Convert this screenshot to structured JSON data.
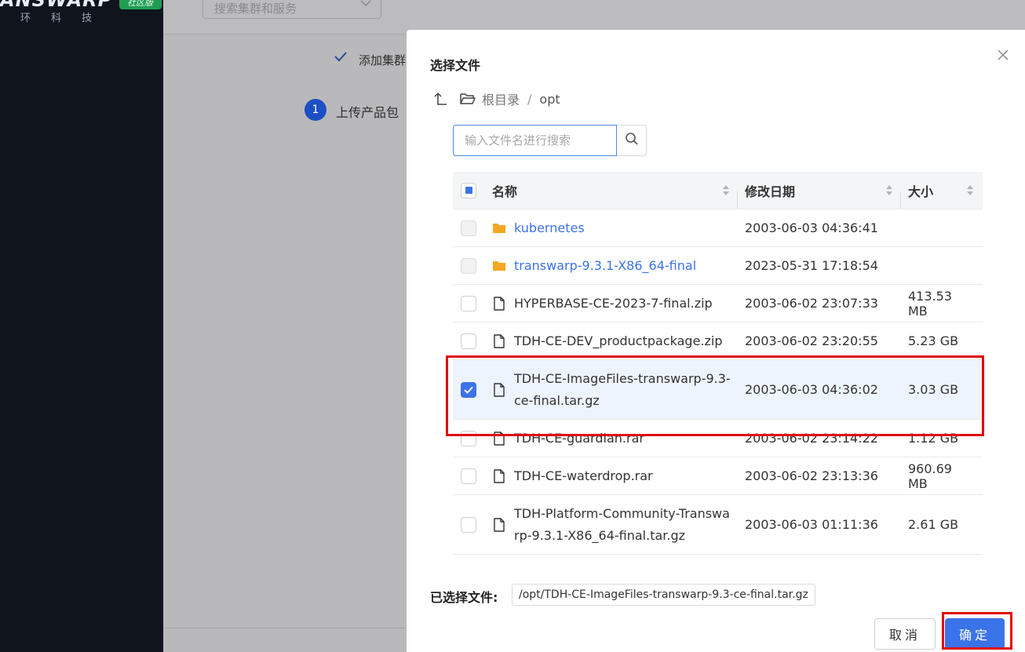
{
  "sidebar": {
    "logo_text": "ANSWARP",
    "logo_badge": "社区版",
    "logo_sub": "环科技"
  },
  "background": {
    "search_placeholder": "搜索集群和服务",
    "step_check_text": "添加集群",
    "step_number": "1",
    "step_text": "上传产品包"
  },
  "dialog": {
    "title": "选择文件",
    "breadcrumb": {
      "root": "根目录",
      "separator": "/",
      "current": "opt"
    },
    "search_placeholder": "输入文件名进行搜索",
    "columns": {
      "name": "名称",
      "date": "修改日期",
      "size": "大小"
    },
    "rows": [
      {
        "type": "folder",
        "name": "kubernetes",
        "date": "2003-06-03 04:36:41",
        "size": "",
        "checked": false,
        "disabled": true
      },
      {
        "type": "folder",
        "name": "transwarp-9.3.1-X86_64-final",
        "date": "2023-05-31 17:18:54",
        "size": "",
        "checked": false,
        "disabled": true
      },
      {
        "type": "file",
        "name": "HYPERBASE-CE-2023-7-final.zip",
        "date": "2003-06-02 23:07:33",
        "size": "413.53 MB",
        "checked": false
      },
      {
        "type": "file",
        "name": "TDH-CE-DEV_productpackage.zip",
        "date": "2003-06-02 23:20:55",
        "size": "5.23 GB",
        "checked": false
      },
      {
        "type": "file",
        "name": "TDH-CE-ImageFiles-transwarp-9.3-ce-final.tar.gz",
        "date": "2003-06-03 04:36:02",
        "size": "3.03 GB",
        "checked": true
      },
      {
        "type": "file",
        "name": "TDH-CE-guardian.rar",
        "date": "2003-06-02 23:14:22",
        "size": "1.12 GB",
        "checked": false
      },
      {
        "type": "file",
        "name": "TDH-CE-waterdrop.rar",
        "date": "2003-06-02 23:13:36",
        "size": "960.69 MB",
        "checked": false
      },
      {
        "type": "file",
        "name": "TDH-Platform-Community-Transwarp-9.3.1-X86_64-final.tar.gz",
        "date": "2003-06-03 01:11:36",
        "size": "2.61 GB",
        "checked": false
      }
    ],
    "selected_label": "已选择文件:",
    "selected_value": "/opt/TDH-CE-ImageFiles-transwarp-9.3-ce-final.tar.gz",
    "cancel_label": "取消",
    "ok_label": "确定"
  },
  "colors": {
    "accent": "#3b73e8",
    "folder": "#f5a623",
    "highlight": "#e10a0a",
    "sidebar_bg": "#0f141d"
  }
}
